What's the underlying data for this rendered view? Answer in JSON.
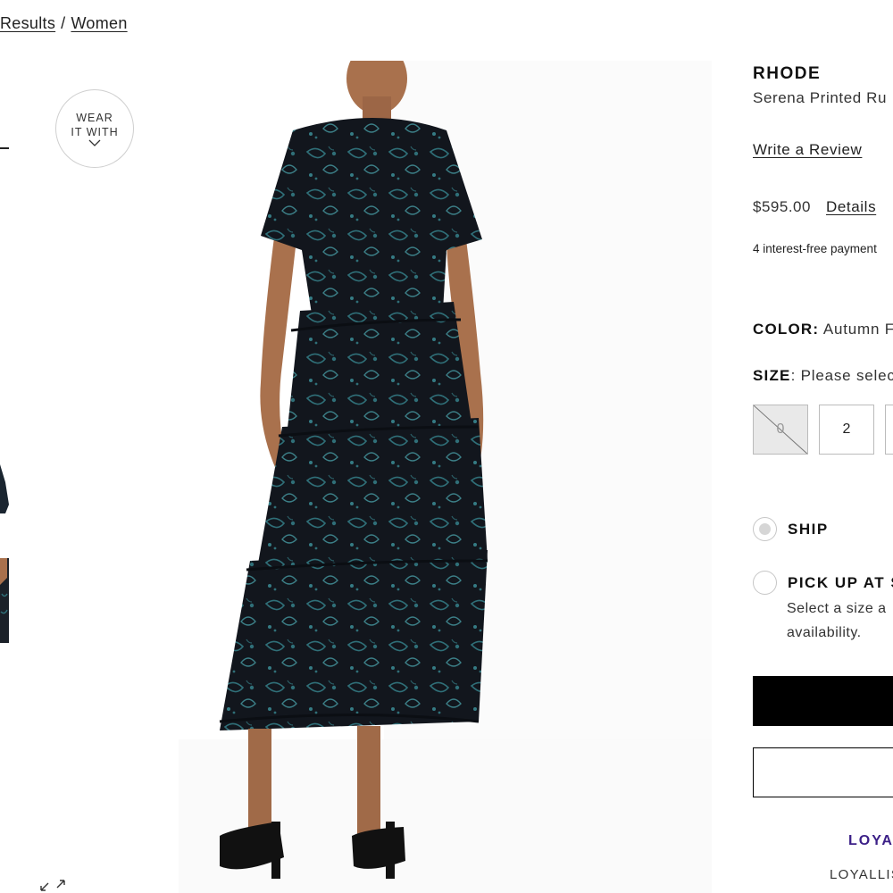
{
  "breadcrumb": {
    "results": "Results",
    "separator": "/",
    "women": "Women"
  },
  "wear_it_with": {
    "line1": "WEAR",
    "line2": "IT WITH",
    "icon": "chevron-down-icon"
  },
  "gallery": {
    "expand_icon": "expand-arrows-icon"
  },
  "product": {
    "brand": "RHODE",
    "name": "Serena Printed Ru",
    "review_link": "Write a Review",
    "price": "$595.00",
    "details_link": "Details",
    "installments": "4 interest-free payment"
  },
  "color": {
    "label": "COLOR:",
    "value": "Autumn F"
  },
  "size": {
    "label": "SIZE",
    "value": ": Please selec",
    "options": [
      {
        "label": "0",
        "available": false
      },
      {
        "label": "2",
        "available": true
      }
    ]
  },
  "fulfillment": {
    "ship_label": "SHIP",
    "pickup_label": "PICK UP AT S",
    "availability_line1": "Select a size a",
    "availability_line2": "availability."
  },
  "loyalty": {
    "label": "LOYA",
    "sub": "LOYALLIS"
  },
  "colors": {
    "text": "#222222",
    "loyalty": "#3b1f87",
    "dress": "#12161d",
    "print": "#2f6f78",
    "skin": "#a9714d",
    "disabled_size_bg": "#e9e9e9"
  }
}
